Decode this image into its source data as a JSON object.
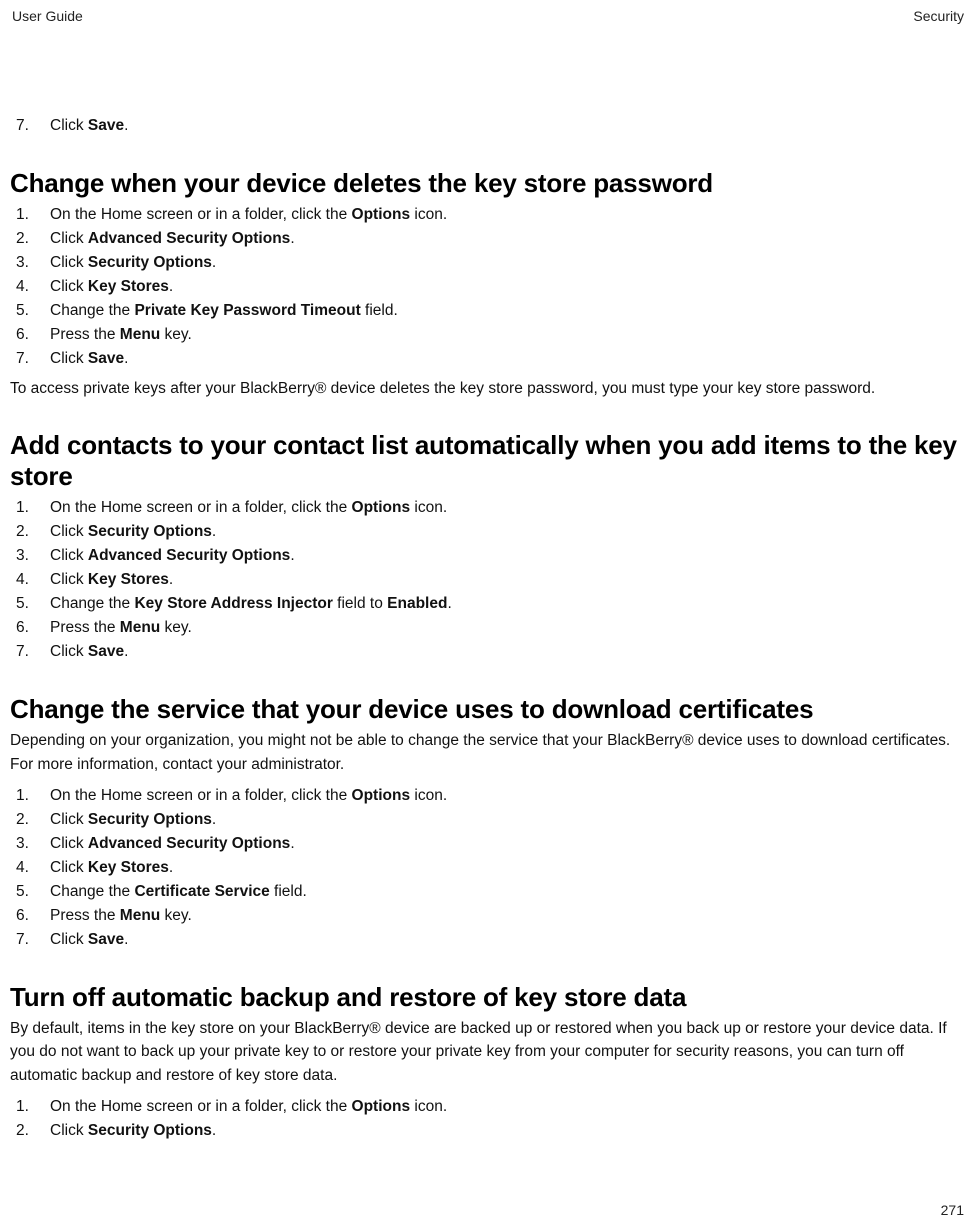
{
  "header": {
    "left": "User Guide",
    "right": "Security"
  },
  "footer": {
    "page_number": "271"
  },
  "intro_list": [
    {
      "n": "7.",
      "pre": "Click ",
      "b1": "Save",
      "post": "."
    }
  ],
  "section1": {
    "title": "Change when your device deletes the key store password",
    "steps": [
      {
        "n": "1.",
        "pre": "On the Home screen or in a folder, click the ",
        "b1": "Options",
        "post": " icon."
      },
      {
        "n": "2.",
        "pre": "Click ",
        "b1": "Advanced Security Options",
        "post": "."
      },
      {
        "n": "3.",
        "pre": "Click ",
        "b1": "Security Options",
        "post": "."
      },
      {
        "n": "4.",
        "pre": "Click ",
        "b1": "Key Stores",
        "post": "."
      },
      {
        "n": "5.",
        "pre": "Change the ",
        "b1": "Private Key Password Timeout",
        "post": " field."
      },
      {
        "n": "6.",
        "pre": "Press the ",
        "b1": "Menu",
        "post": " key."
      },
      {
        "n": "7.",
        "pre": "Click ",
        "b1": "Save",
        "post": "."
      }
    ],
    "after": "To access private keys after your BlackBerry® device deletes the key store password, you must type your key store password."
  },
  "section2": {
    "title": "Add contacts to your contact list automatically when you add items to the key store",
    "steps": [
      {
        "n": "1.",
        "pre": "On the Home screen or in a folder, click the ",
        "b1": "Options",
        "post": " icon."
      },
      {
        "n": "2.",
        "pre": "Click ",
        "b1": "Security Options",
        "post": "."
      },
      {
        "n": "3.",
        "pre": "Click ",
        "b1": "Advanced Security Options",
        "post": "."
      },
      {
        "n": "4.",
        "pre": "Click ",
        "b1": "Key Stores",
        "post": "."
      },
      {
        "n": "5.",
        "pre": "Change the ",
        "b1": "Key Store Address Injector",
        "mid": " field to ",
        "b2": "Enabled",
        "post": "."
      },
      {
        "n": "6.",
        "pre": "Press the ",
        "b1": "Menu",
        "post": " key."
      },
      {
        "n": "7.",
        "pre": "Click ",
        "b1": "Save",
        "post": "."
      }
    ]
  },
  "section3": {
    "title": "Change the service that your device uses to download certificates",
    "intro": "Depending on your organization, you might not be able to change the service that your BlackBerry® device uses to download certificates. For more information, contact your administrator.",
    "steps": [
      {
        "n": "1.",
        "pre": "On the Home screen or in a folder, click the ",
        "b1": "Options",
        "post": " icon."
      },
      {
        "n": "2.",
        "pre": "Click ",
        "b1": "Security Options",
        "post": "."
      },
      {
        "n": "3.",
        "pre": "Click ",
        "b1": "Advanced Security Options",
        "post": "."
      },
      {
        "n": "4.",
        "pre": "Click ",
        "b1": "Key Stores",
        "post": "."
      },
      {
        "n": "5.",
        "pre": "Change the ",
        "b1": "Certificate Service",
        "post": " field."
      },
      {
        "n": "6.",
        "pre": "Press the ",
        "b1": "Menu",
        "post": " key."
      },
      {
        "n": "7.",
        "pre": "Click ",
        "b1": "Save",
        "post": "."
      }
    ]
  },
  "section4": {
    "title": "Turn off automatic backup and restore of key store data",
    "intro": "By default, items in the key store on your BlackBerry® device are backed up or restored when you back up or restore your device data. If you do not want to back up your private key to or restore your private key from your computer for security reasons, you can turn off automatic backup and restore of key store data.",
    "steps": [
      {
        "n": "1.",
        "pre": "On the Home screen or in a folder, click the ",
        "b1": "Options",
        "post": " icon."
      },
      {
        "n": "2.",
        "pre": "Click ",
        "b1": "Security Options",
        "post": "."
      }
    ]
  }
}
